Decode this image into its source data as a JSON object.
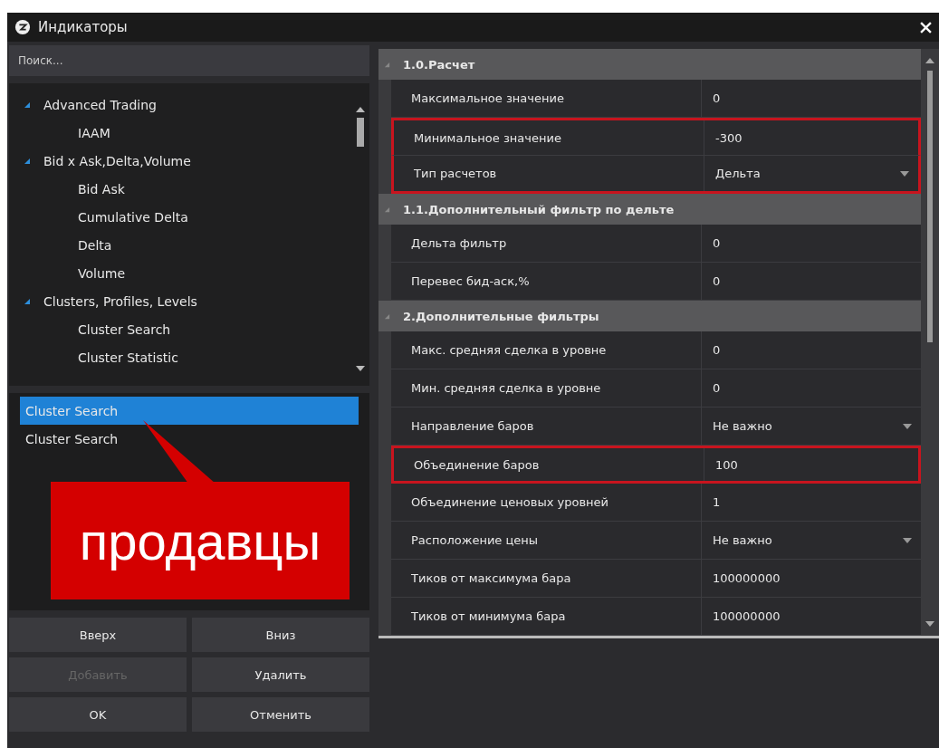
{
  "window": {
    "title": "Индикаторы"
  },
  "search": {
    "placeholder": "Поиск..."
  },
  "tree": [
    {
      "label": "Advanced Trading",
      "expanded": true,
      "children": [
        {
          "label": "IAAM"
        }
      ]
    },
    {
      "label": "Bid x Ask,Delta,Volume",
      "expanded": true,
      "children": [
        {
          "label": "Bid Ask"
        },
        {
          "label": "Cumulative Delta"
        },
        {
          "label": "Delta"
        },
        {
          "label": "Volume"
        }
      ]
    },
    {
      "label": "Clusters, Profiles, Levels",
      "expanded": true,
      "children": [
        {
          "label": "Cluster Search"
        },
        {
          "label": "Cluster Statistic"
        }
      ]
    }
  ],
  "selected_list": [
    {
      "label": "Cluster Search",
      "selected": true
    },
    {
      "label": "Cluster Search",
      "selected": false
    }
  ],
  "callout": {
    "text": "продавцы"
  },
  "buttons": [
    {
      "label": "Вверх",
      "disabled": false
    },
    {
      "label": "Вниз",
      "disabled": false
    },
    {
      "label": "Добавить",
      "disabled": true
    },
    {
      "label": "Удалить",
      "disabled": false
    },
    {
      "label": "OK",
      "disabled": false
    },
    {
      "label": "Отменить",
      "disabled": false
    }
  ],
  "properties": [
    {
      "kind": "section",
      "label": "1.0.Расчет",
      "expanded": true
    },
    {
      "kind": "text",
      "label": "Максимальное значение",
      "value": "0",
      "highlighted": false
    },
    {
      "kind": "text",
      "label": "Минимальное значение",
      "value": "-300",
      "highlighted": true
    },
    {
      "kind": "dropdown",
      "label": "Тип расчетов",
      "value": "Дельта",
      "highlighted": true
    },
    {
      "kind": "section",
      "label": "1.1.Дополнительный фильтр по дельте",
      "expanded": true
    },
    {
      "kind": "text",
      "label": "Дельта фильтр",
      "value": "0",
      "highlighted": false
    },
    {
      "kind": "text",
      "label": "Перевес бид-аск,%",
      "value": "0",
      "highlighted": false
    },
    {
      "kind": "section",
      "label": "2.Дополнительные фильтры",
      "expanded": true
    },
    {
      "kind": "text",
      "label": "Макс. средняя сделка в уровне",
      "value": "0",
      "highlighted": false
    },
    {
      "kind": "text",
      "label": "Мин. средняя сделка в уровне",
      "value": "0",
      "highlighted": false
    },
    {
      "kind": "dropdown",
      "label": "Направление баров",
      "value": "Не важно",
      "highlighted": false
    },
    {
      "kind": "text",
      "label": "Объединение баров",
      "value": "100",
      "highlighted": true
    },
    {
      "kind": "text",
      "label": "Объединение ценовых уровней",
      "value": "1",
      "highlighted": false
    },
    {
      "kind": "dropdown",
      "label": "Расположение цены",
      "value": "Не важно",
      "highlighted": false
    },
    {
      "kind": "text",
      "label": "Тиков от максимума бара",
      "value": "100000000",
      "highlighted": false
    },
    {
      "kind": "text",
      "label": "Тиков от минимума бара",
      "value": "100000000",
      "highlighted": false
    }
  ]
}
